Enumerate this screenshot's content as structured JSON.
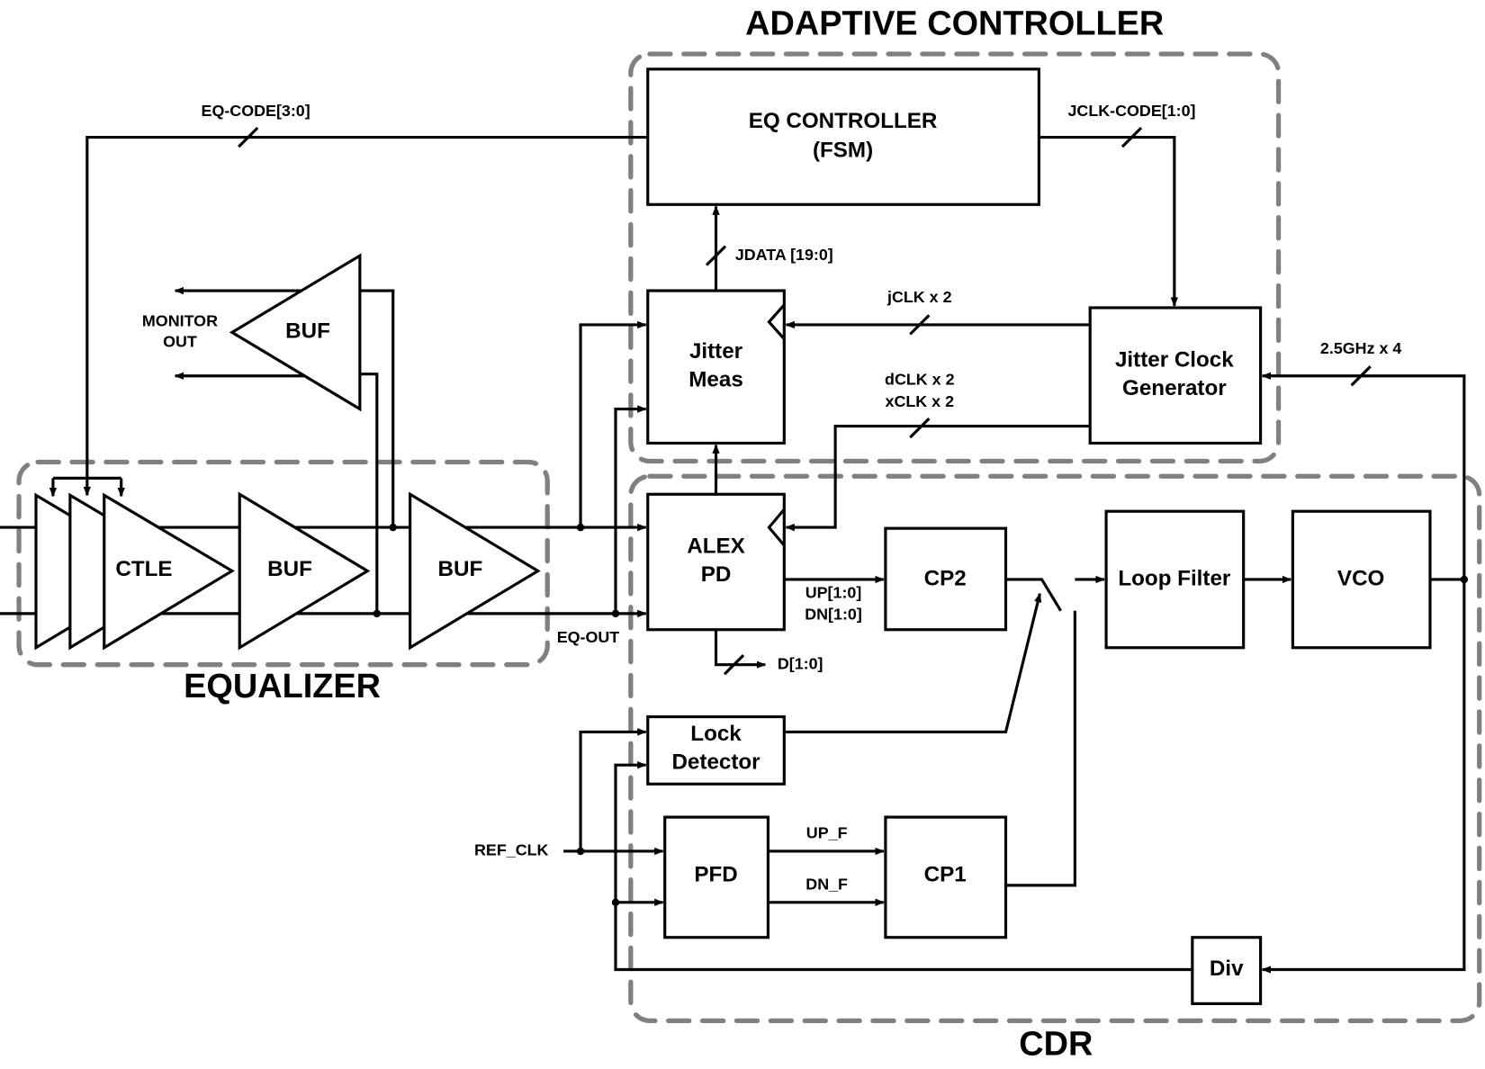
{
  "groups": {
    "adaptive_controller": "ADAPTIVE CONTROLLER",
    "equalizer": "EQUALIZER",
    "cdr": "CDR"
  },
  "blocks": {
    "eq_controller": [
      "EQ CONTROLLER",
      "(FSM)"
    ],
    "jitter_meas": [
      "Jitter",
      "Meas"
    ],
    "jitter_clock_gen": [
      "Jitter Clock",
      "Generator"
    ],
    "alex_pd": [
      "ALEX",
      "PD"
    ],
    "cp2": "CP2",
    "loop_filter": "Loop Filter",
    "vco": "VCO",
    "lock_detector": [
      "Lock",
      "Detector"
    ],
    "pfd": "PFD",
    "cp1": "CP1",
    "div": "Div",
    "ctle": "CTLE",
    "buf1": "BUF",
    "buf2": "BUF",
    "monitor_buf": "BUF"
  },
  "signals": {
    "eq_code": "EQ-CODE[3:0]",
    "jclk_code": "JCLK-CODE[1:0]",
    "jdata": "JDATA [19:0]",
    "jclk": "jCLK x 2",
    "dclk": "dCLK x 2",
    "xclk": "xCLK x 2",
    "ghz": "2.5GHz x 4",
    "up": "UP[1:0]",
    "dn": "DN[1:0]",
    "d": "D[1:0]",
    "up_f": "UP_F",
    "dn_f": "DN_F",
    "ref_clk": "REF_CLK",
    "eq_out": "EQ-OUT",
    "monitor_out": [
      "MONITOR",
      "OUT"
    ]
  },
  "colors": {
    "line": "#000000",
    "group_border": "#808080"
  }
}
